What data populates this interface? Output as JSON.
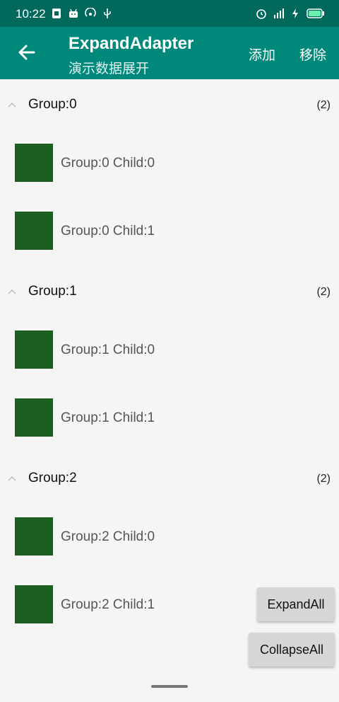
{
  "status_bar": {
    "time": "10:22",
    "left_icons": [
      "sim-card-icon",
      "android-icon",
      "hotspot-icon",
      "usb-icon"
    ],
    "right_icons": [
      "alarm-icon",
      "signal-4g-icon",
      "charging-icon",
      "battery-icon"
    ]
  },
  "app_bar": {
    "title": "ExpandAdapter",
    "subtitle": "演示数据展开",
    "actions": {
      "add": "添加",
      "remove": "移除"
    },
    "colors": {
      "primary": "#00897b",
      "primary_dark": "#00695c"
    }
  },
  "groups": [
    {
      "label": "Group:0",
      "count": "(2)",
      "children": [
        "Group:0 Child:0",
        "Group:0 Child:1"
      ]
    },
    {
      "label": "Group:1",
      "count": "(2)",
      "children": [
        "Group:1 Child:0",
        "Group:1 Child:1"
      ]
    },
    {
      "label": "Group:2",
      "count": "(2)",
      "children": [
        "Group:2 Child:0",
        "Group:2 Child:1"
      ]
    }
  ],
  "buttons": {
    "expand_all": "ExpandAll",
    "collapse_all": "CollapseAll"
  },
  "thumb_color": "#1b5e20"
}
